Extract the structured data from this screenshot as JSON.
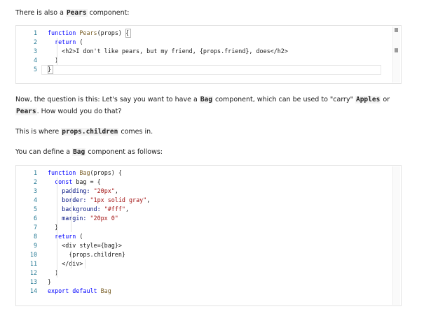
{
  "intro": {
    "before": "There is also a ",
    "code": "Pears",
    "after": " component:"
  },
  "code_block_1": {
    "line_numbers": [
      "1",
      "2",
      "3",
      "4",
      "5"
    ],
    "lines": [
      [
        {
          "t": "function ",
          "c": "kw"
        },
        {
          "t": "Pears",
          "c": "fn"
        },
        {
          "t": "(props) {",
          "c": "plain"
        }
      ],
      [
        {
          "t": "  return ",
          "c": "kw"
        },
        {
          "t": "(",
          "c": "plain"
        }
      ],
      [
        {
          "t": "    <h2>I don't like pears, but my friend, {props.friend}, does</h2>",
          "c": "plain"
        }
      ],
      [
        {
          "t": "  )",
          "c": "plain"
        }
      ],
      [
        {
          "t": "}",
          "c": "plain"
        }
      ]
    ]
  },
  "question": {
    "p1": "Now, the question is this: Let's say you want to have a ",
    "c1": "Bag",
    "p2": " component, which can be used to \"carry\" ",
    "c2": "Apples",
    "p3": " or ",
    "c3": "Pears",
    "p4": ". How would you do that?"
  },
  "children_note": {
    "before": "This is where ",
    "code": "props.children",
    "after": " comes in."
  },
  "define_note": {
    "before": "You can define a ",
    "code": "Bag",
    "after": " component as follows:"
  },
  "code_block_2": {
    "line_numbers": [
      "1",
      "2",
      "3",
      "4",
      "5",
      "6",
      "7",
      "8",
      "9",
      "10",
      "11",
      "12",
      "13",
      "14"
    ],
    "lines": [
      [
        {
          "t": "function ",
          "c": "kw"
        },
        {
          "t": "Bag",
          "c": "fn"
        },
        {
          "t": "(props) {",
          "c": "plain"
        }
      ],
      [
        {
          "t": "  const ",
          "c": "kw"
        },
        {
          "t": "bag = {",
          "c": "plain"
        }
      ],
      [
        {
          "t": "    padding: ",
          "c": "prop"
        },
        {
          "t": "\"20px\"",
          "c": "str"
        },
        {
          "t": ",",
          "c": "plain"
        }
      ],
      [
        {
          "t": "    border: ",
          "c": "prop"
        },
        {
          "t": "\"1px solid gray\"",
          "c": "str"
        },
        {
          "t": ",",
          "c": "plain"
        }
      ],
      [
        {
          "t": "    background: ",
          "c": "prop"
        },
        {
          "t": "\"#fff\"",
          "c": "str"
        },
        {
          "t": ",",
          "c": "plain"
        }
      ],
      [
        {
          "t": "    margin: ",
          "c": "prop"
        },
        {
          "t": "\"20px 0\"",
          "c": "str"
        }
      ],
      [
        {
          "t": "  }",
          "c": "plain"
        }
      ],
      [
        {
          "t": "  return ",
          "c": "kw"
        },
        {
          "t": "(",
          "c": "plain"
        }
      ],
      [
        {
          "t": "    <div style={bag}>",
          "c": "plain"
        }
      ],
      [
        {
          "t": "      {props.children}",
          "c": "plain"
        }
      ],
      [
        {
          "t": "    </div>",
          "c": "plain"
        }
      ],
      [
        {
          "t": "  )",
          "c": "plain"
        }
      ],
      [
        {
          "t": "}",
          "c": "plain"
        }
      ],
      [
        {
          "t": "export default ",
          "c": "kw"
        },
        {
          "t": "Bag",
          "c": "fn"
        }
      ]
    ]
  }
}
